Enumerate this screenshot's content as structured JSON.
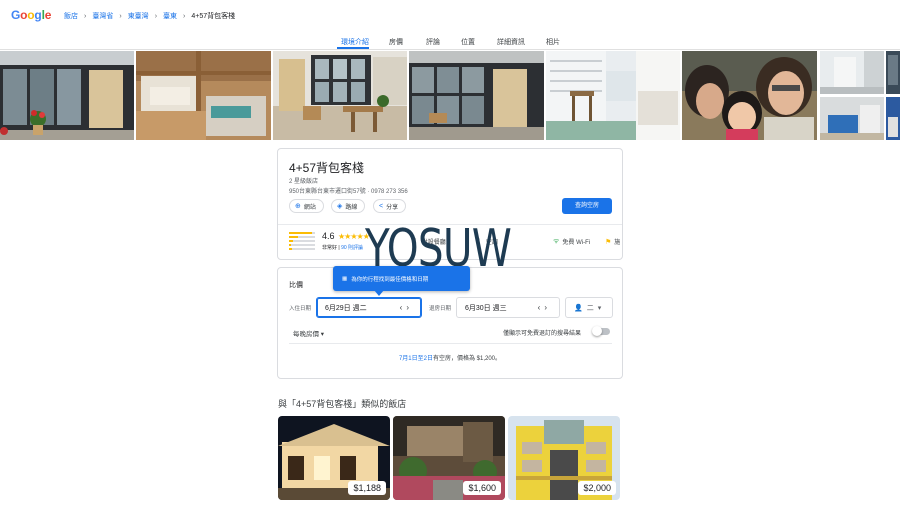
{
  "logo": {
    "letters": [
      "G",
      "o",
      "o",
      "g",
      "l",
      "e"
    ],
    "colors": [
      "#4285f4",
      "#ea4335",
      "#fbbc05",
      "#4285f4",
      "#34a853",
      "#ea4335"
    ]
  },
  "breadcrumbs": [
    "飯店",
    "臺灣省",
    "東臺灣",
    "臺東",
    "4+57背包客棧"
  ],
  "tabs": [
    "環境介紹",
    "房價",
    "評論",
    "位置",
    "詳細資訊",
    "相片"
  ],
  "hotel": {
    "name": "4+57背包客棧",
    "class": "2 星級飯店",
    "address": "950台東縣台東市遷口街57號 · 0978 273 356",
    "actions": {
      "website": "網站",
      "directions": "路線",
      "share": "分享"
    },
    "check_availability": "查詢空房",
    "rating": "4.6",
    "stars": "★★★★★",
    "rating_text": "非常好",
    "review_count": "90 則評論",
    "rating_bars": [
      0.9,
      0.35,
      0.15,
      0.08,
      0.12
    ],
    "amenities": [
      {
        "icon": "restaurant-icon",
        "label": "附設餐廳"
      },
      {
        "icon": "thermometer-icon",
        "label": "空調"
      },
      {
        "icon": "wifi-icon",
        "label": "免費 Wi-Fi"
      },
      {
        "icon": "flag-icon",
        "label": "施"
      }
    ]
  },
  "watermark": "YOSUW",
  "pricing": {
    "title": "比價",
    "tooltip": "為你的行程找到最佳價格和日期",
    "checkin_label": "入住日期",
    "checkin_value": "6月29日 週二",
    "checkout_label": "退房日期",
    "checkout_value": "6月30日 週三",
    "guests": "二",
    "per_night": "每晚房價 ▾",
    "free_cancel": "僅顯示可免費退訂的搜尋結果",
    "availability_dates": "7月1日至2日",
    "availability_rest": "有空房，價格為 $1,200。"
  },
  "similar": {
    "title": "與「4+57背包客棧」類似的飯店",
    "hotels": [
      {
        "price": "$1,188"
      },
      {
        "price": "$1,600"
      },
      {
        "price": "$2,000"
      }
    ]
  }
}
